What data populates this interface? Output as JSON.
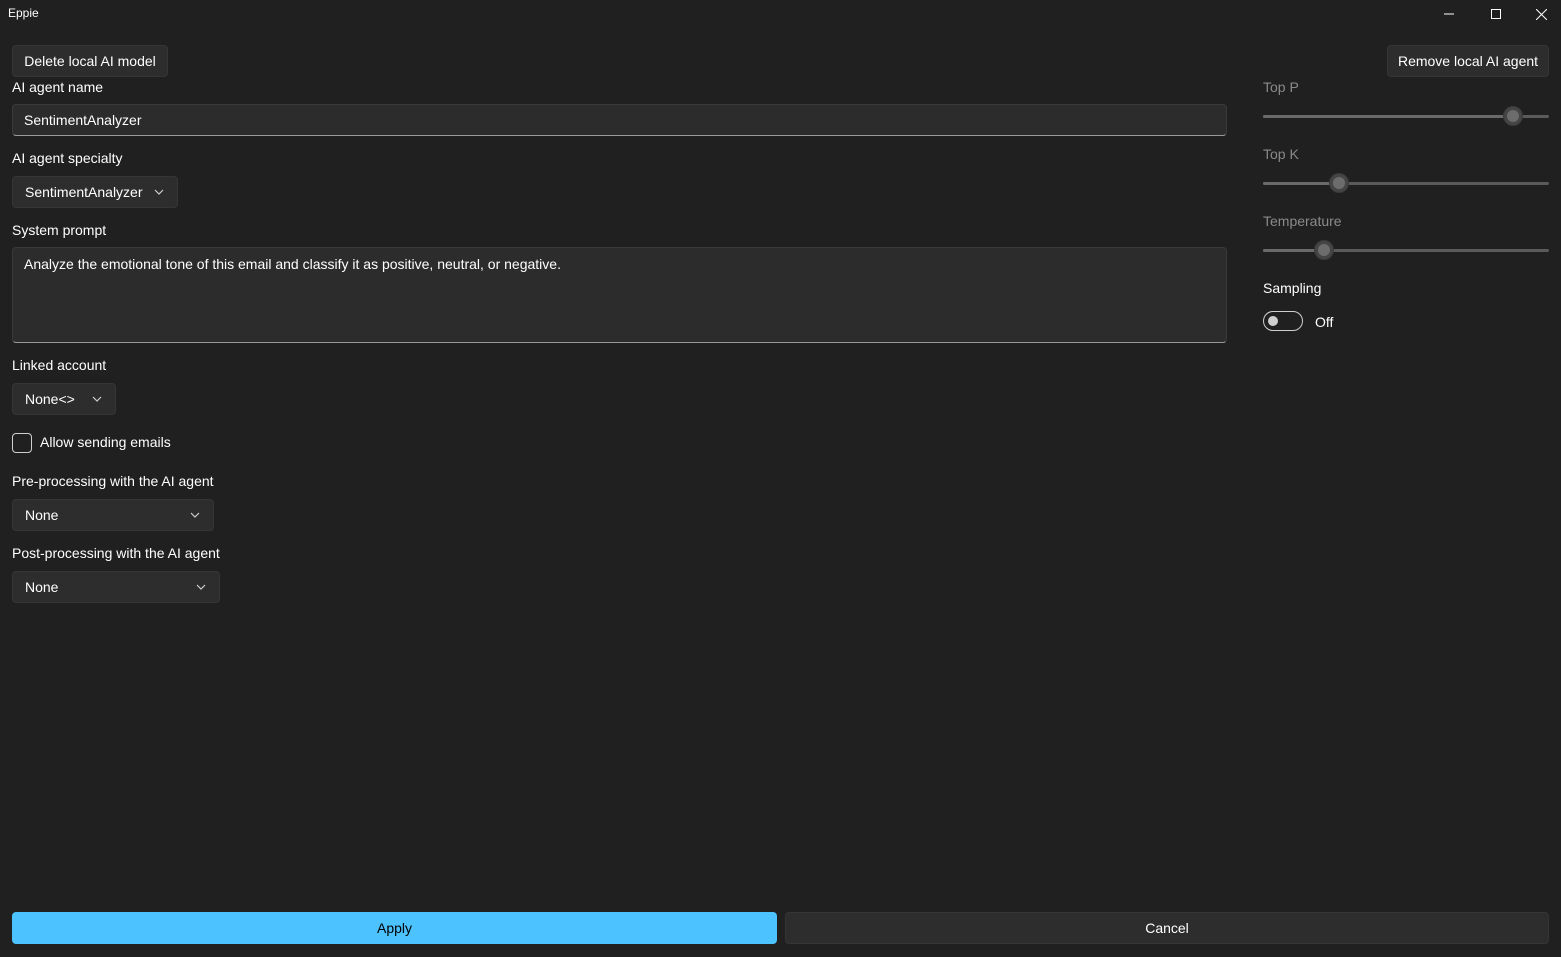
{
  "window": {
    "title": "Eppie",
    "minimize_icon": "minimize-icon",
    "maximize_icon": "maximize-icon",
    "close_icon": "close-icon"
  },
  "toolbar": {
    "delete_model_label": "Delete local AI model",
    "remove_agent_label": "Remove local AI agent"
  },
  "form": {
    "agent_name_label": "AI agent name",
    "agent_name_value": "SentimentAnalyzer",
    "specialty_label": "AI agent specialty",
    "specialty_value": "SentimentAnalyzer",
    "system_prompt_label": "System prompt",
    "system_prompt_value": "Analyze the emotional tone of this email and classify it as positive, neutral, or negative.",
    "linked_account_label": "Linked account",
    "linked_account_value": "None<>",
    "allow_sending_label": "Allow sending emails",
    "allow_sending_checked": false,
    "preprocessing_label": "Pre-processing with the AI agent",
    "preprocessing_value": "None",
    "postprocessing_label": "Post-processing with the AI agent",
    "postprocessing_value": "None"
  },
  "settings": {
    "top_p_label": "Top P",
    "top_p_level": 0.875,
    "top_k_label": "Top K",
    "top_k_level": 0.265,
    "temperature_label": "Temperature",
    "temperature_level": 0.215,
    "sampling_label": "Sampling",
    "sampling_state": "Off",
    "sampling_on": false
  },
  "footer": {
    "apply_label": "Apply",
    "cancel_label": "Cancel"
  },
  "colors": {
    "background": "#202020",
    "accent": "#4cc2ff",
    "control": "#2d2d2d"
  }
}
